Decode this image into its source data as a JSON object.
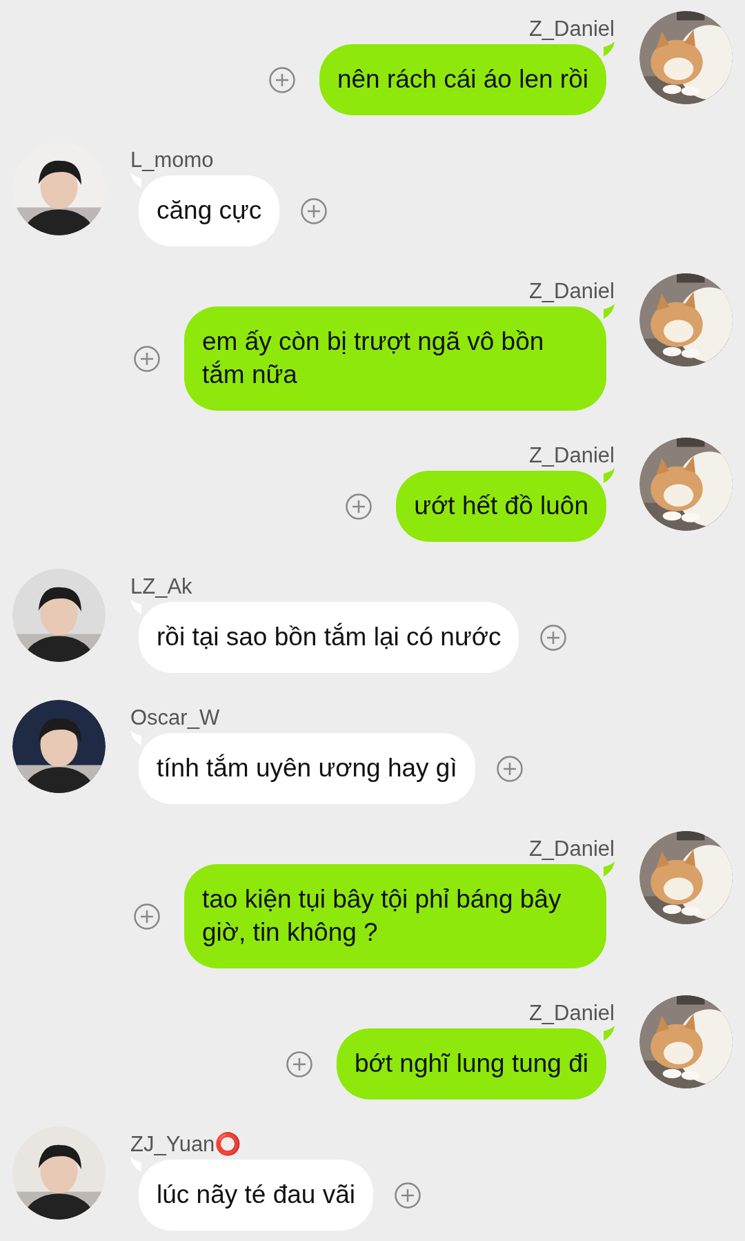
{
  "messages": [
    {
      "kind": "outgoing",
      "name": "Z_Daniel",
      "text": "nên rách cái áo len rồi"
    },
    {
      "kind": "incoming",
      "name": "L_momo",
      "text": "căng cực"
    },
    {
      "kind": "outgoing",
      "name": "Z_Daniel",
      "text": "em ấy còn bị trượt ngã vô bồn tắm nữa"
    },
    {
      "kind": "outgoing",
      "name": "Z_Daniel",
      "text": "ướt hết đồ luôn"
    },
    {
      "kind": "incoming",
      "name": "LZ_Ak",
      "text": "rồi tại sao bồn tắm lại có nước"
    },
    {
      "kind": "incoming",
      "name": "Oscar_W",
      "text": "tính tắm uyên ương hay gì"
    },
    {
      "kind": "outgoing",
      "name": "Z_Daniel",
      "text": "tao kiện tụi bây tội phỉ báng bây giờ, tin không ?"
    },
    {
      "kind": "outgoing",
      "name": "Z_Daniel",
      "text": "bớt nghĩ lung tung đi"
    },
    {
      "kind": "incoming",
      "name": "ZJ_Yuan⭕",
      "text": "lúc nãy té đau vãi"
    }
  ]
}
